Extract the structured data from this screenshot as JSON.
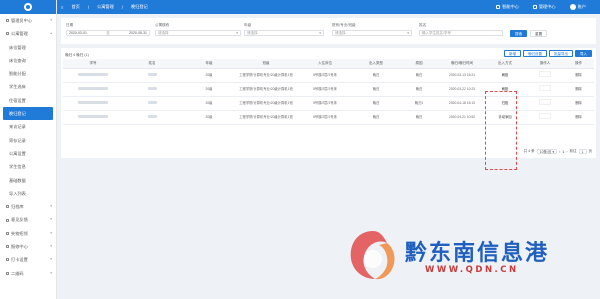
{
  "topbar": {
    "breadcrumb": [
      "首页",
      "公寓管理",
      "晚归登记"
    ],
    "right": [
      "智能中心",
      "管理中心",
      "账户"
    ]
  },
  "sidebar": {
    "items": [
      {
        "label": "管理员中心",
        "sub": false,
        "active": false,
        "arrow": "▾"
      },
      {
        "label": "公寓管理",
        "sub": false,
        "active": false,
        "arrow": "▴"
      },
      {
        "label": "床位管理",
        "sub": true,
        "active": false
      },
      {
        "label": "床位查询",
        "sub": true,
        "active": false
      },
      {
        "label": "智能分配",
        "sub": true,
        "active": false
      },
      {
        "label": "学生选床",
        "sub": true,
        "active": false
      },
      {
        "label": "住宿设置",
        "sub": true,
        "active": false
      },
      {
        "label": "晚归登记",
        "sub": true,
        "active": true
      },
      {
        "label": "来访记录",
        "sub": true,
        "active": false
      },
      {
        "label": "寄存记录",
        "sub": true,
        "active": false
      },
      {
        "label": "公寓设置",
        "sub": true,
        "active": false
      },
      {
        "label": "学生信息",
        "sub": true,
        "active": false
      },
      {
        "label": "基础数据",
        "sub": true,
        "active": false
      },
      {
        "label": "导入列表",
        "sub": true,
        "active": false
      },
      {
        "label": "归档库",
        "sub": false,
        "active": false,
        "arrow": "▾"
      },
      {
        "label": "意见反馈",
        "sub": false,
        "active": false,
        "arrow": "▾"
      },
      {
        "label": "失物招领",
        "sub": false,
        "active": false,
        "arrow": "▾"
      },
      {
        "label": "报修中心",
        "sub": false,
        "active": false,
        "arrow": "▾"
      },
      {
        "label": "打卡设置",
        "sub": false,
        "active": false,
        "arrow": "▾"
      },
      {
        "label": "二维码",
        "sub": false,
        "active": false,
        "arrow": "▾"
      }
    ]
  },
  "filters": {
    "date": {
      "label": "日期",
      "start": "2020-03-01",
      "sep": "至",
      "end": "2020-05-31"
    },
    "building": {
      "label": "公寓楼栋",
      "placeholder": "请选择"
    },
    "grade": {
      "label": "年级",
      "placeholder": "请选择"
    },
    "college": {
      "label": "院系/专业/班级",
      "placeholder": "请选择"
    },
    "keyword": {
      "label": "姓名",
      "placeholder": "输入学生姓名/学号"
    },
    "search_btn": "搜索",
    "reset_btn": "重置"
  },
  "table": {
    "summary": "晚归 4  晚归 (1)",
    "actions": [
      "新增",
      "晚归设置",
      "批量导出",
      "导入"
    ],
    "columns": [
      "学号",
      "姓名",
      "年级",
      "班级",
      "入住床位",
      "出入类型",
      "原因",
      "晚归/晚归时间",
      "出入方式",
      "操作人",
      "操作"
    ],
    "rows": [
      {
        "grade": "20级",
        "class": "工程学院/计算机专业/20级计算机1班",
        "bed": "5号楼/2层/1号床",
        "type": "晚归",
        "reason": "晚归",
        "time": "2020-03-13 15:21",
        "method": "刷脸",
        "op": "删除"
      },
      {
        "grade": "20级",
        "class": "工程学院/计算机专业/20级计算机1班",
        "bed": "5号楼/2层/1号床",
        "type": "晚归",
        "reason": "晚归",
        "time": "2020-03-22 10:23",
        "method": "刷脸",
        "op": "删除"
      },
      {
        "grade": "20级",
        "class": "工程学院/计算机专业/20级计算机1班",
        "bed": "5号楼/2层/1号床",
        "type": "晚归",
        "reason": "晚归1",
        "time": "2020-04-18 15:13",
        "method": "扫脸",
        "op": "删除"
      },
      {
        "grade": "20级",
        "class": "工程学院/计算机专业/20级计算机1班",
        "bed": "5号楼/2层/1号床",
        "type": "晚归",
        "reason": "晚归",
        "time": "2020-04-21 10:52",
        "method": "手动添加",
        "op": "删除"
      }
    ]
  },
  "pager": {
    "total": "共 4 条",
    "size": "10条/页",
    "page": "1",
    "goto": "前往",
    "goto_page": "1",
    "unit": "页"
  },
  "watermark": {
    "text": "黔东南信息港",
    "url": "WWW.QDN.CN"
  }
}
